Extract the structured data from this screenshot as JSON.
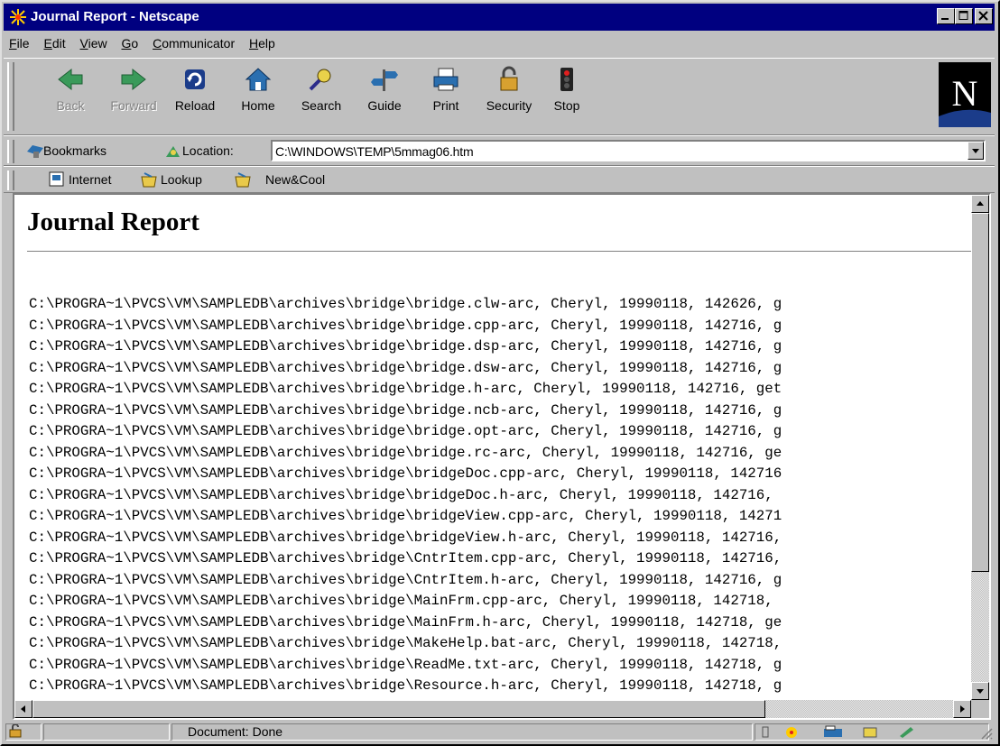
{
  "window": {
    "title": "Journal Report - Netscape"
  },
  "menu": [
    "File",
    "Edit",
    "View",
    "Go",
    "Communicator",
    "Help"
  ],
  "menu_underline": [
    "F",
    "E",
    "V",
    "G",
    "C",
    "H"
  ],
  "navigation": {
    "buttons": [
      {
        "label": "Back",
        "icon": "back-arrow-icon",
        "enabled": false
      },
      {
        "label": "Forward",
        "icon": "forward-arrow-icon",
        "enabled": false
      },
      {
        "label": "Reload",
        "icon": "reload-icon",
        "enabled": true
      },
      {
        "label": "Home",
        "icon": "home-icon",
        "enabled": true
      },
      {
        "label": "Search",
        "icon": "search-icon",
        "enabled": true
      },
      {
        "label": "Guide",
        "icon": "guide-icon",
        "enabled": true
      },
      {
        "label": "Print",
        "icon": "print-icon",
        "enabled": true
      },
      {
        "label": "Security",
        "icon": "security-lock-icon",
        "enabled": true
      },
      {
        "label": "Stop",
        "icon": "stop-icon",
        "enabled": true
      }
    ],
    "logo": "N"
  },
  "location_bar": {
    "bookmarks_label": "Bookmarks",
    "location_label": "Location:",
    "url": "C:\\WINDOWS\\TEMP\\5mmag06.htm"
  },
  "personal_toolbar": [
    "Internet",
    "Lookup",
    "New&Cool"
  ],
  "document": {
    "heading": "Journal Report",
    "lines": [
      "C:\\PROGRA~1\\PVCS\\VM\\SAMPLEDB\\archives\\bridge\\bridge.clw-arc, Cheryl, 19990118, 142626, g",
      "C:\\PROGRA~1\\PVCS\\VM\\SAMPLEDB\\archives\\bridge\\bridge.cpp-arc, Cheryl, 19990118, 142716, g",
      "C:\\PROGRA~1\\PVCS\\VM\\SAMPLEDB\\archives\\bridge\\bridge.dsp-arc, Cheryl, 19990118, 142716, g",
      "C:\\PROGRA~1\\PVCS\\VM\\SAMPLEDB\\archives\\bridge\\bridge.dsw-arc, Cheryl, 19990118, 142716, g",
      "C:\\PROGRA~1\\PVCS\\VM\\SAMPLEDB\\archives\\bridge\\bridge.h-arc, Cheryl, 19990118, 142716, get",
      "C:\\PROGRA~1\\PVCS\\VM\\SAMPLEDB\\archives\\bridge\\bridge.ncb-arc, Cheryl, 19990118, 142716, g",
      "C:\\PROGRA~1\\PVCS\\VM\\SAMPLEDB\\archives\\bridge\\bridge.opt-arc, Cheryl, 19990118, 142716, g",
      "C:\\PROGRA~1\\PVCS\\VM\\SAMPLEDB\\archives\\bridge\\bridge.rc-arc, Cheryl, 19990118, 142716, ge",
      "C:\\PROGRA~1\\PVCS\\VM\\SAMPLEDB\\archives\\bridge\\bridgeDoc.cpp-arc, Cheryl, 19990118, 142716",
      "C:\\PROGRA~1\\PVCS\\VM\\SAMPLEDB\\archives\\bridge\\bridgeDoc.h-arc, Cheryl, 19990118, 142716,",
      "C:\\PROGRA~1\\PVCS\\VM\\SAMPLEDB\\archives\\bridge\\bridgeView.cpp-arc, Cheryl, 19990118, 14271",
      "C:\\PROGRA~1\\PVCS\\VM\\SAMPLEDB\\archives\\bridge\\bridgeView.h-arc, Cheryl, 19990118, 142716,",
      "C:\\PROGRA~1\\PVCS\\VM\\SAMPLEDB\\archives\\bridge\\CntrItem.cpp-arc, Cheryl, 19990118, 142716,",
      "C:\\PROGRA~1\\PVCS\\VM\\SAMPLEDB\\archives\\bridge\\CntrItem.h-arc, Cheryl, 19990118, 142716, g",
      "C:\\PROGRA~1\\PVCS\\VM\\SAMPLEDB\\archives\\bridge\\MainFrm.cpp-arc, Cheryl, 19990118, 142718,",
      "C:\\PROGRA~1\\PVCS\\VM\\SAMPLEDB\\archives\\bridge\\MainFrm.h-arc, Cheryl, 19990118, 142718, ge",
      "C:\\PROGRA~1\\PVCS\\VM\\SAMPLEDB\\archives\\bridge\\MakeHelp.bat-arc, Cheryl, 19990118, 142718,",
      "C:\\PROGRA~1\\PVCS\\VM\\SAMPLEDB\\archives\\bridge\\ReadMe.txt-arc, Cheryl, 19990118, 142718, g",
      "C:\\PROGRA~1\\PVCS\\VM\\SAMPLEDB\\archives\\bridge\\Resource.h-arc, Cheryl, 19990118, 142718, g"
    ]
  },
  "status": {
    "text": "Document: Done"
  },
  "colors": {
    "titlebar": "#000080",
    "face": "#c0c0c0",
    "page": "#ffffff"
  }
}
